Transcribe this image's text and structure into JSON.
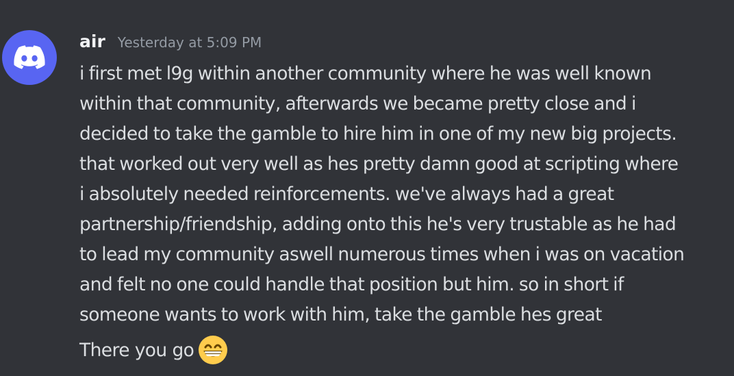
{
  "message": {
    "author": "air",
    "timestamp": "Yesterday at 5:09 PM",
    "avatar_icon": "discord-logo-icon",
    "avatar_color": "#5865F2",
    "content": "i first met l9g within another community where he was well known\nwithin that community, afterwards we became pretty close and i\ndecided to take the gamble to hire him in one of my new big projects.\nthat worked out very well as hes pretty damn good at scripting where\ni absolutely needed reinforcements. we've always had a great\npartnership/friendship, adding onto this he's very trustable as he had\nto lead my community aswell numerous times when i was on vacation\nand felt no one could handle that position but him. so in short if\nsomeone wants to work with him, take the gamble hes great",
    "followup_text": "There you go",
    "followup_emoji": "grin-emoji-icon"
  },
  "colors": {
    "background": "#313338",
    "username": "#f2f3f5",
    "timestamp": "#949ba4",
    "text": "#dbdee1"
  }
}
